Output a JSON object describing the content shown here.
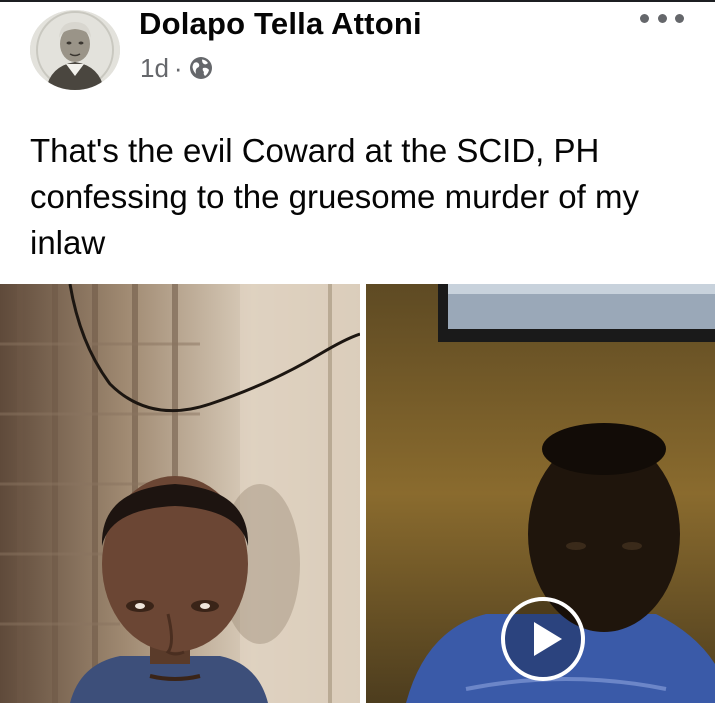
{
  "post": {
    "author_name": "Dolapo Tella Attoni",
    "time_ago": "1d",
    "separator": "·",
    "privacy_icon": "globe-icon",
    "more_icon": "more-options-icon",
    "text": "That's the evil Coward at the SCID, PH confessing to the gruesome murder of my inlaw"
  },
  "media": {
    "items": [
      {
        "type": "photo"
      },
      {
        "type": "video",
        "play_icon": "play-icon"
      }
    ]
  },
  "colors": {
    "text_primary": "#050505",
    "text_secondary": "#65676b",
    "background": "#ffffff"
  }
}
